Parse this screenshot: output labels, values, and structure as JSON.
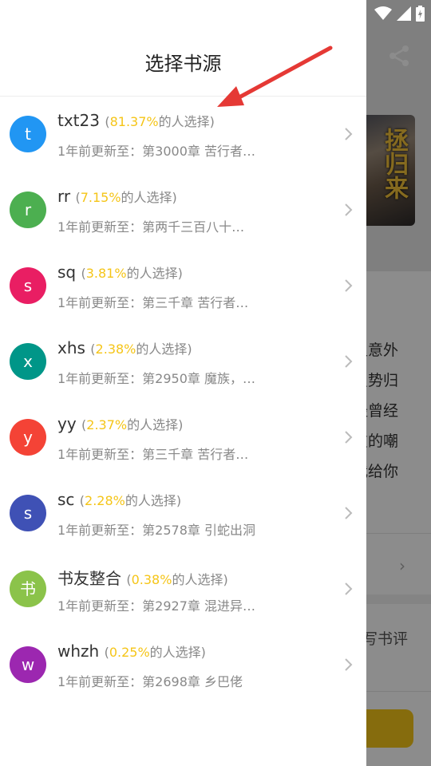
{
  "status": {
    "icons": [
      "wifi-icon",
      "signal-icon",
      "battery-charging-icon"
    ]
  },
  "background": {
    "cover_title": "拯归来",
    "description_fragments": [
      "卫意外",
      "虽势归",
      "经曾经",
      "友的嘲",
      "我给你"
    ],
    "row_label": ")",
    "write_review": "写书评"
  },
  "drawer": {
    "title": "选择书源",
    "sources": [
      {
        "avatar_letter": "t",
        "avatar_color": "#2196f3",
        "name": "txt23",
        "percent": "81.37%",
        "suffix": "的人选择)",
        "update": "1年前更新至：第3000章 苦行者…"
      },
      {
        "avatar_letter": "r",
        "avatar_color": "#4caf50",
        "name": "rr",
        "percent": "7.15%",
        "suffix": "的人选择)",
        "update": "1年前更新至：第两千三百八十…"
      },
      {
        "avatar_letter": "s",
        "avatar_color": "#e91e63",
        "name": "sq",
        "percent": "3.81%",
        "suffix": "的人选择)",
        "update": "1年前更新至：第三千章 苦行者…"
      },
      {
        "avatar_letter": "x",
        "avatar_color": "#009688",
        "name": "xhs",
        "percent": "2.38%",
        "suffix": "的人选择)",
        "update": "1年前更新至：第2950章 魔族，…"
      },
      {
        "avatar_letter": "y",
        "avatar_color": "#f44336",
        "name": "yy",
        "percent": "2.37%",
        "suffix": "的人选择)",
        "update": "1年前更新至：第三千章 苦行者…"
      },
      {
        "avatar_letter": "s",
        "avatar_color": "#3f51b5",
        "name": "sc",
        "percent": "2.28%",
        "suffix": "的人选择)",
        "update": "1年前更新至：第2578章 引蛇出洞"
      },
      {
        "avatar_letter": "书",
        "avatar_color": "#8bc34a",
        "name": "书友整合",
        "percent": "0.38%",
        "suffix": "的人选择)",
        "update": "1年前更新至：第2927章 混进异…"
      },
      {
        "avatar_letter": "w",
        "avatar_color": "#9c27b0",
        "name": "whzh",
        "percent": "0.25%",
        "suffix": "的人选择)",
        "update": "1年前更新至：第2698章 乡巴佬"
      }
    ]
  },
  "annotation": {
    "arrow_color": "#e53935"
  }
}
